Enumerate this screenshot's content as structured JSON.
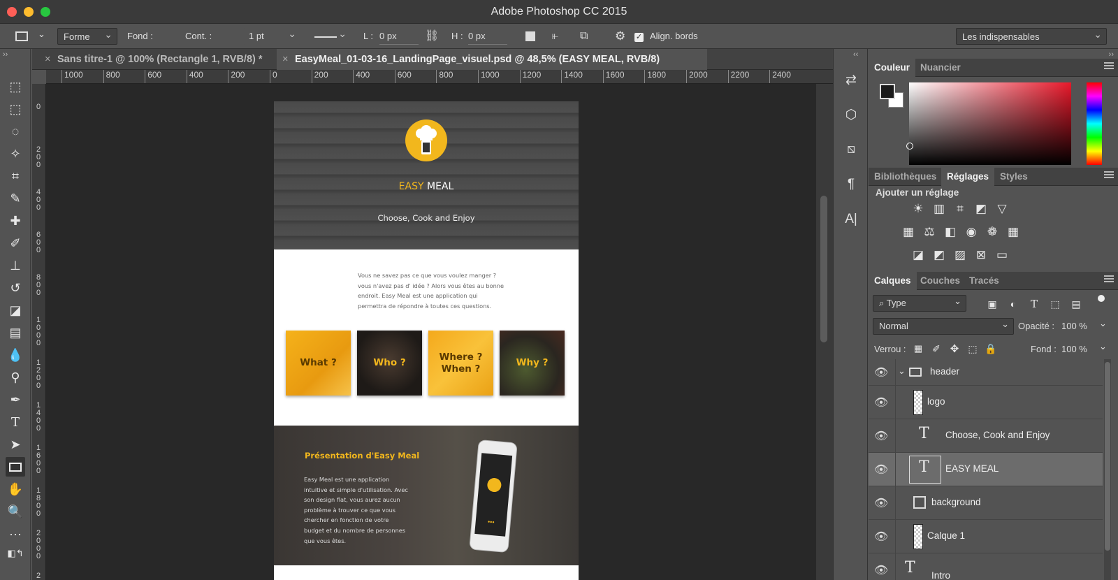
{
  "window": {
    "title": "Adobe Photoshop CC 2015",
    "traffic_colors": [
      "#ff5f57",
      "#febc2e",
      "#28c840"
    ]
  },
  "options_bar": {
    "mode": "Forme",
    "fill_label": "Fond :",
    "stroke_label": "Cont. :",
    "stroke_width": "1 pt",
    "width_label": "L :",
    "width_value": "0 px",
    "height_label": "H :",
    "height_value": "0 px",
    "align_edges_label": "Align. bords",
    "workspace": "Les indispensables"
  },
  "tabs": [
    {
      "label": "Sans titre-1 @ 100% (Rectangle 1, RVB/8) *"
    },
    {
      "label": "EasyMeal_01-03-16_LandingPage_visuel.psd @ 48,5% (EASY MEAL, RVB/8)"
    }
  ],
  "ruler_h": [
    "1000",
    "800",
    "600",
    "400",
    "200",
    "0",
    "200",
    "400",
    "600",
    "800",
    "1000",
    "1200",
    "1400",
    "1600",
    "1800",
    "2000",
    "2200",
    "2400"
  ],
  "ruler_v": [
    "0",
    "2\n0\n0",
    "4\n0\n0",
    "6\n0\n0",
    "8\n0\n0",
    "1\n0\n0\n0",
    "1\n2\n0\n0",
    "1\n4\n0\n0",
    "1\n6\n0\n0",
    "1\n8\n0\n0",
    "2\n0\n0\n0",
    "2"
  ],
  "document": {
    "brand_highlight": "EASY",
    "brand_rest": " MEAL",
    "tagline": "Choose, Cook and Enjoy",
    "intro": "Vous ne savez pas ce que vous voulez manger ? vous n'avez pas d' idée ? Alors vous êtes au bonne endroit. Easy Meal est une application qui permettra de répondre à toutes ces questions.",
    "cards": [
      {
        "label": "What ?"
      },
      {
        "label": "Who ?"
      },
      {
        "label": "Where ?\nWhen ?"
      },
      {
        "label": "Why ?"
      }
    ],
    "presentation_title": "Présentation d'Easy Meal",
    "presentation_body": "Easy Meal est une application intuitive et simple d'utilisation. Avec son design flat, vous aurez aucun problème à trouver ce que vous chercher en fonction de votre budget et du nombre de personnes que vous êtes.",
    "accent_color": "#f2b71d"
  },
  "color_panel": {
    "tabs": [
      "Couleur",
      "Nuancier"
    ]
  },
  "adjustments_panel": {
    "tabs": [
      "Bibliothèques",
      "Réglages",
      "Styles"
    ],
    "heading": "Ajouter un réglage"
  },
  "layers_panel": {
    "tabs": [
      "Calques",
      "Couches",
      "Tracés"
    ],
    "filter": "Type",
    "blend_mode": "Normal",
    "opacity_label": "Opacité :",
    "opacity_value": "100 %",
    "lock_label": "Verrou :",
    "fill_label": "Fond :",
    "fill_value": "100 %",
    "layers": [
      {
        "name": "header",
        "kind": "group"
      },
      {
        "name": "logo",
        "kind": "pixel"
      },
      {
        "name": "Choose, Cook and Enjoy",
        "kind": "text"
      },
      {
        "name": "EASY MEAL",
        "kind": "text",
        "selected": true
      },
      {
        "name": "background",
        "kind": "smart"
      },
      {
        "name": "Calque 1",
        "kind": "pixel"
      },
      {
        "name": "Intro",
        "kind": "text"
      }
    ]
  }
}
